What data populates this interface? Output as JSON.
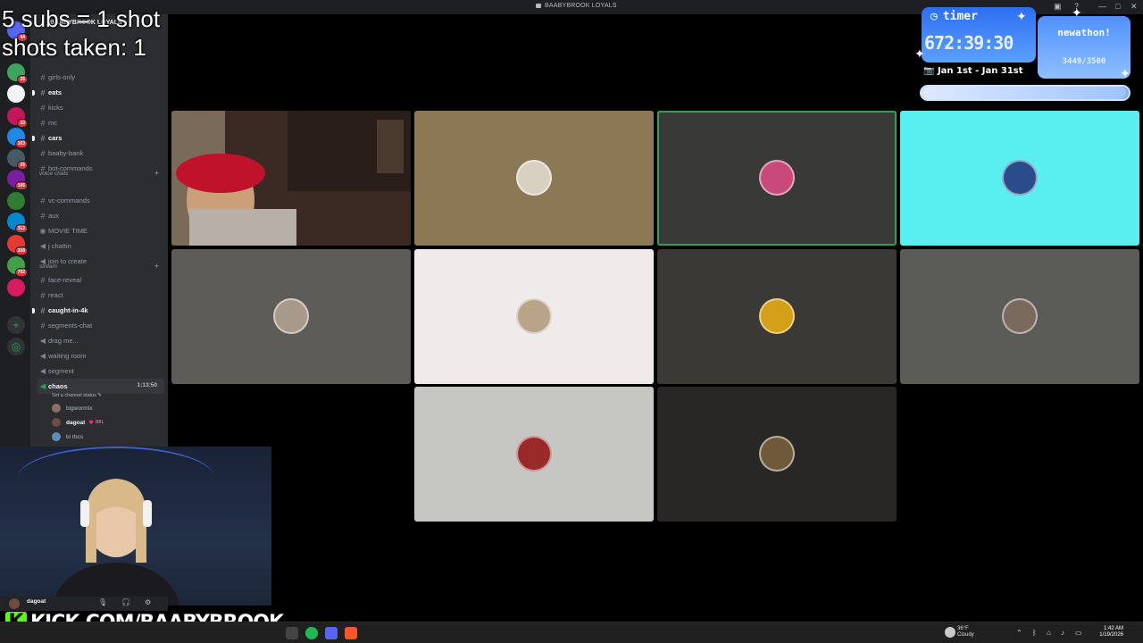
{
  "window": {
    "title": "BAABYBROOK LOYALS"
  },
  "overlay": {
    "subs_rule": "5 subs = 1 shot",
    "shots_taken": "shots taken: 1"
  },
  "server_rail": {
    "servers": [
      {
        "badge": "44",
        "color": "#5865f2"
      },
      {
        "badge": "26",
        "color": "#3ba55d"
      },
      {
        "badge": "",
        "color": "#f2f3f5"
      },
      {
        "badge": "10",
        "color": "#c2185b"
      },
      {
        "badge": "103",
        "color": "#1e88e5"
      },
      {
        "badge": "26",
        "color": "#455a64"
      },
      {
        "badge": "196",
        "color": "#7b1fa2"
      },
      {
        "badge": "",
        "color": "#2e7d32"
      },
      {
        "badge": "313",
        "color": "#0288d1"
      },
      {
        "badge": "208",
        "color": "#e53935"
      },
      {
        "badge": "702",
        "color": "#43a047"
      },
      {
        "badge": "",
        "color": "#d81b60"
      }
    ]
  },
  "sidebar": {
    "server_name": "BAABYBROOK LOYALS",
    "channels": [
      {
        "name": "girls-only",
        "type": "text",
        "bold": false
      },
      {
        "name": "eats",
        "type": "text",
        "bold": true
      },
      {
        "name": "kicks",
        "type": "text",
        "bold": false
      },
      {
        "name": "mc",
        "type": "text",
        "bold": false
      },
      {
        "name": "cars",
        "type": "text",
        "bold": true
      },
      {
        "name": "baaby-bank",
        "type": "text",
        "bold": false
      },
      {
        "name": "bot-commands",
        "type": "text",
        "bold": false
      }
    ],
    "cat_voice": "voice chats",
    "voice_channels": [
      {
        "name": "vc-commands",
        "type": "text"
      },
      {
        "name": "aux",
        "type": "text"
      },
      {
        "name": "MOVIE TIME",
        "type": "stage"
      },
      {
        "name": "j chattin",
        "type": "voice"
      },
      {
        "name": "join to create",
        "type": "voice"
      }
    ],
    "cat_stream": "stream",
    "stream_channels": [
      {
        "name": "face-reveal",
        "type": "text",
        "bold": false
      },
      {
        "name": "react",
        "type": "text",
        "bold": false
      },
      {
        "name": "caught-in-4k",
        "type": "text",
        "bold": true
      },
      {
        "name": "segments-chat",
        "type": "text",
        "bold": false
      },
      {
        "name": "drag me...",
        "type": "voice",
        "bold": false
      },
      {
        "name": "waiting room",
        "type": "voice",
        "bold": false
      },
      {
        "name": "segment",
        "type": "voice",
        "bold": false
      }
    ],
    "active_channel": "chaos",
    "active_timer": "1:13:50",
    "channel_status": "Set a channel status",
    "vc_users": [
      {
        "name": "bigwormtx",
        "color": "#8d6e63"
      },
      {
        "name": "dagoat",
        "color": "#6d4c41",
        "tag": "💗 BBL"
      },
      {
        "name": "bi rbcs",
        "color": "#5c8fb8"
      }
    ]
  },
  "video_grid": {
    "tiles": [
      {
        "id": "cam",
        "bg": "#3b2a24",
        "speaking": true,
        "pfp": ""
      },
      {
        "id": "u2",
        "bg": "#8b7955",
        "speaking": false,
        "pfp": "#d8d0c0"
      },
      {
        "id": "u3",
        "bg": "#393a37",
        "speaking": true,
        "pfp": "#c94a7a"
      },
      {
        "id": "u4",
        "bg": "#59eef0",
        "speaking": false,
        "pfp": "#2a4c8a"
      },
      {
        "id": "u5",
        "bg": "#5d5c58",
        "speaking": false,
        "pfp": "#a89a8a"
      },
      {
        "id": "u6",
        "bg": "#efebeb",
        "speaking": false,
        "pfp": "#b8a488"
      },
      {
        "id": "u7",
        "bg": "#3a3936",
        "speaking": false,
        "pfp": "#d4a017"
      },
      {
        "id": "u8",
        "bg": "#5b5b57",
        "speaking": false,
        "pfp": "#7a6a5e"
      },
      {
        "id": "u9",
        "bg": "#c6c7c2",
        "speaking": false,
        "pfp": "#9a2a2a"
      },
      {
        "id": "u10",
        "bg": "#282726",
        "speaking": false,
        "pfp": "#6e5a3a"
      }
    ]
  },
  "user_panel": {
    "username": "dagoat"
  },
  "brand": {
    "k": "K",
    "url": "KICK.COM/BAABYBROOK"
  },
  "subathon": {
    "timer_label": "timer",
    "timer_value": "672:39:30",
    "goal_title": "newathon!",
    "goal_count": "3449/3500",
    "goal_progress": 0.985,
    "date_range": "Jan 1st - Jan 31st"
  },
  "taskbar": {
    "weather_temp": "36°F",
    "weather_desc": "Cloudy",
    "time": "1:42 AM",
    "date": "1/19/2026"
  }
}
